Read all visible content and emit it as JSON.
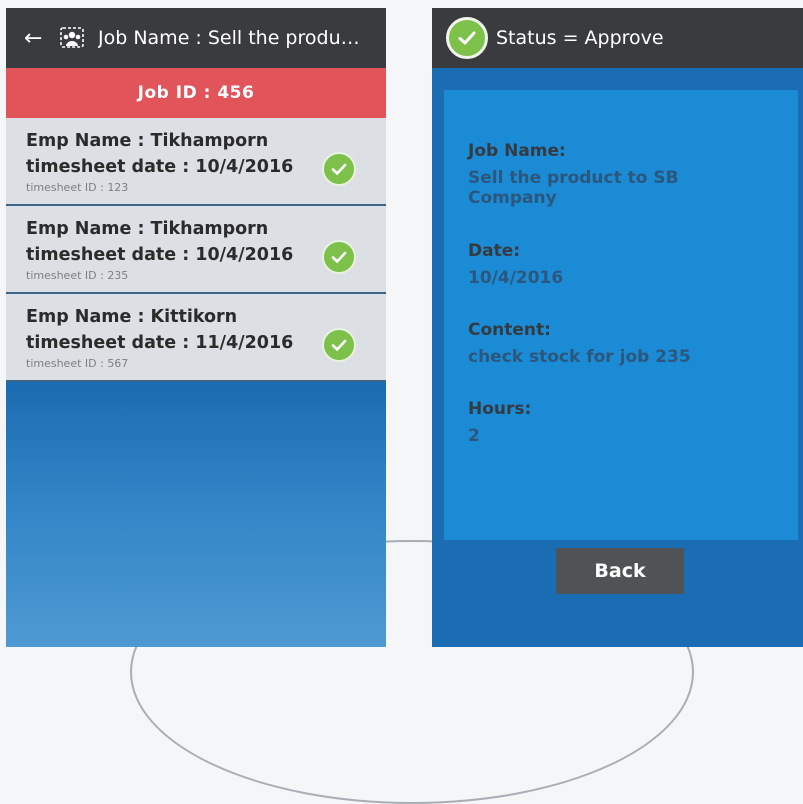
{
  "left_screen": {
    "appbar": {
      "back_icon": "arrow-left-icon",
      "job_icon": "job-group-icon",
      "title": "Job Name : Sell the produ…"
    },
    "job_id": "Job ID : 456",
    "items": [
      {
        "emp": "Emp Name : Tikhamporn",
        "date": "timesheet date : 10/4/2016",
        "sheet_id": "timesheet ID : 123",
        "status_icon": "check-circle-icon"
      },
      {
        "emp": "Emp Name : Tikhamporn",
        "date": "timesheet date : 10/4/2016",
        "sheet_id": "timesheet ID : 235",
        "status_icon": "check-circle-icon"
      },
      {
        "emp": "Emp Name : Kittikorn",
        "date": "timesheet date : 11/4/2016",
        "sheet_id": "timesheet ID : 567",
        "status_icon": "check-circle-icon"
      }
    ]
  },
  "right_screen": {
    "appbar": {
      "status_icon": "check-circle-icon",
      "title": "Status = Approve"
    },
    "fields": {
      "job_name": {
        "label": "Job Name:",
        "value": "Sell the product to SB Company"
      },
      "date": {
        "label": "Date:",
        "value": "10/4/2016"
      },
      "content": {
        "label": "Content:",
        "value": "check stock for job 235"
      },
      "hours": {
        "label": "Hours:",
        "value": "2"
      }
    },
    "back_label": "Back"
  },
  "colors": {
    "appbar": "#3a3b3e",
    "job_id_bar": "#e0545a",
    "list_item": "#dcdfe3",
    "screen_bg": "#1a6db3",
    "detail_card": "#1b8bd6",
    "check": "#7dc04a",
    "back_button": "#4f5355"
  }
}
